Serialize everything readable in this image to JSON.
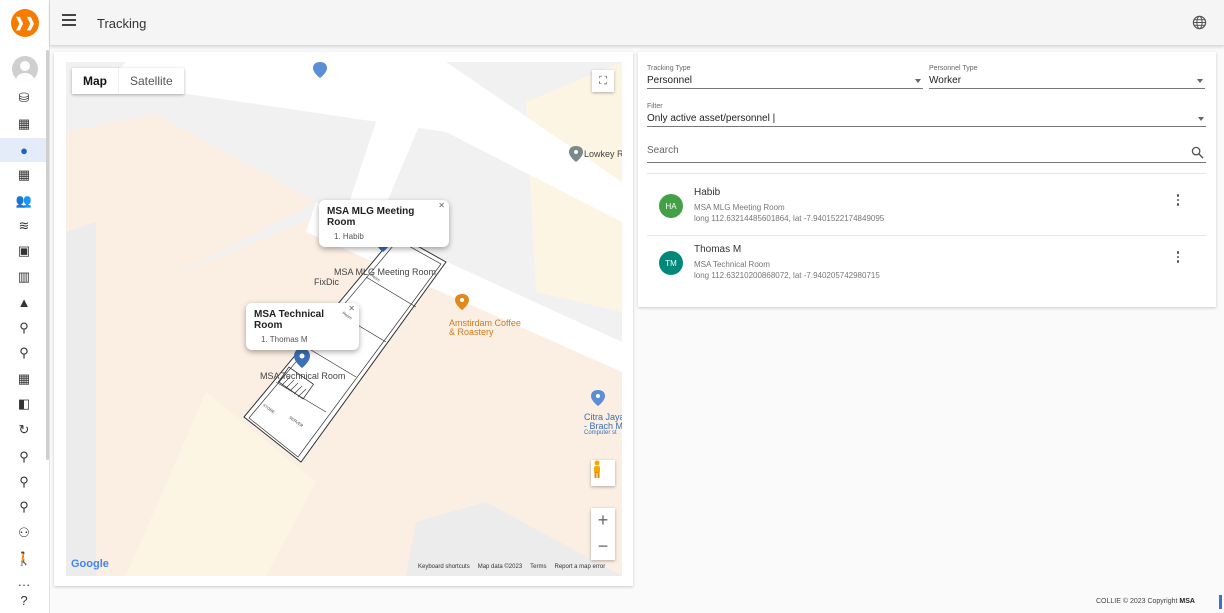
{
  "app": {
    "logo": "❱❱",
    "title": "Tracking"
  },
  "header": {
    "menu_icon": "menu-icon",
    "globe_icon": "globe-icon"
  },
  "rail": [
    {
      "icon": "database-icon",
      "glyph": "⛁"
    },
    {
      "icon": "table-icon",
      "glyph": "▦"
    },
    {
      "icon": "location-pin-icon",
      "glyph": "●",
      "active": true
    },
    {
      "icon": "grid-icon",
      "glyph": "▦"
    },
    {
      "icon": "people-icon",
      "glyph": "👥"
    },
    {
      "icon": "layers-icon",
      "glyph": "≋"
    },
    {
      "icon": "cards-icon",
      "glyph": "▣"
    },
    {
      "icon": "building-icon",
      "glyph": "▥"
    },
    {
      "icon": "landscape-icon",
      "glyph": "▲"
    },
    {
      "icon": "person-icon",
      "glyph": "⚲"
    },
    {
      "icon": "org-icon",
      "glyph": "⚲"
    },
    {
      "icon": "apartment-icon",
      "glyph": "▦"
    },
    {
      "icon": "style-icon",
      "glyph": "◧"
    },
    {
      "icon": "rotate-person-icon",
      "glyph": "↻"
    },
    {
      "icon": "person-edit-icon",
      "glyph": "⚲"
    },
    {
      "icon": "person-alert-icon",
      "glyph": "⚲"
    },
    {
      "icon": "person-settings-icon",
      "glyph": "⚲"
    },
    {
      "icon": "groups-icon",
      "glyph": "⚇"
    },
    {
      "icon": "walk-icon",
      "glyph": "🚶"
    },
    {
      "icon": "more-icon",
      "glyph": "…"
    },
    {
      "icon": "help-icon",
      "glyph": "?"
    }
  ],
  "map": {
    "map_button": "Map",
    "satellite_button": "Satellite",
    "google_logo": "Google",
    "footer": {
      "shortcuts": "Keyboard shortcuts",
      "data": "Map data ©2023",
      "terms": "Terms",
      "report": "Report a map error"
    },
    "popups": [
      {
        "title": "MSA MLG Meeting Room",
        "line": "1. Habib"
      },
      {
        "title": "MSA Technical Room",
        "line": "1. Thomas M"
      }
    ],
    "labels": {
      "meeting_room": "MSA MLG Meeting Room",
      "technical_room": "MSA Technical Room",
      "fixdic": "FixDic",
      "lowkey": "Lowkey R",
      "coffee_1": "Amstirdam Coffee",
      "coffee_2": "& Roastery",
      "citra_1": "Citra Jaya",
      "citra_2": "- Brach M",
      "citra_3": "Computer st",
      "room_a": "Room",
      "room_b": "Room",
      "room_c": "STORE",
      "room_d": "SERVER"
    }
  },
  "filters": {
    "tracking_type": {
      "label": "Tracking Type",
      "value": "Personnel"
    },
    "personnel_type": {
      "label": "Personnel Type",
      "value": "Worker"
    },
    "filter": {
      "label": "Filter",
      "value": "Only active asset/personnel |"
    },
    "search": {
      "placeholder": "Search"
    }
  },
  "personnel": [
    {
      "initials": "HA",
      "name": "Habib",
      "room": "MSA MLG Meeting Room",
      "coords": "long 112.63214485601864, lat -7.9401522174849095",
      "color": "#43a047"
    },
    {
      "initials": "TM",
      "name": "Thomas M",
      "room": "MSA Technical Room",
      "coords": "long 112.63210200868072, lat -7.940205742980715",
      "color": "#00897b"
    }
  ],
  "footer": {
    "text": "COLLIE © 2023 Copyright",
    "brand": "MSA"
  }
}
